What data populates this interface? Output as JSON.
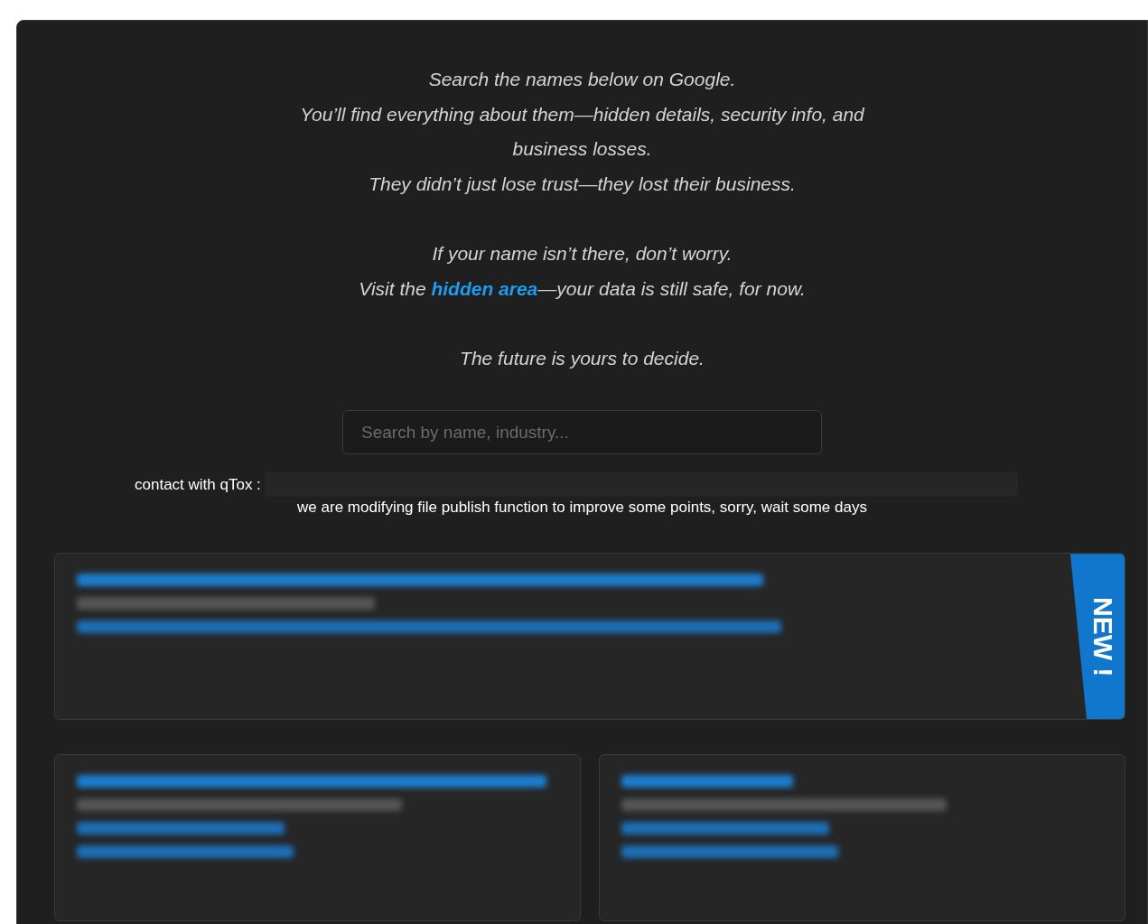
{
  "intro_blocks": [
    {
      "lines": [
        {
          "text": "Search the names below on Google."
        },
        {
          "text": "You’ll find everything about them—hidden details, security info, and"
        },
        {
          "text": "business losses."
        },
        {
          "text": "They didn’t just lose trust—they lost their business."
        }
      ]
    },
    {
      "lines": [
        {
          "text": "If your name isn’t there, don’t worry."
        },
        {
          "before": "Visit the ",
          "link": "hidden area",
          "after": "—your data is still safe, for now."
        }
      ]
    },
    {
      "lines": [
        {
          "text": "The future is yours to decide."
        }
      ]
    }
  ],
  "search": {
    "placeholder": "Search by name, industry..."
  },
  "contact": {
    "label": "contact with qTox :"
  },
  "notice": "we are modifying file publish function to improve some points, sorry, wait some days",
  "ribbon": "NEW !",
  "cards": [
    {
      "new": true,
      "wide": true
    },
    {
      "new": false,
      "wide": false
    },
    {
      "new": false,
      "wide": false
    }
  ]
}
